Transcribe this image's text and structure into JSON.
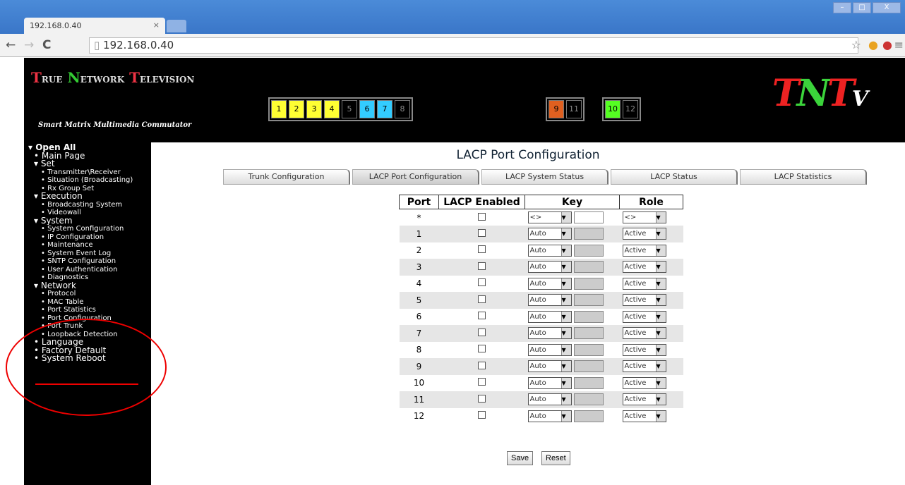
{
  "browser": {
    "tab_title": "192.168.0.40",
    "tab_close": "×",
    "url": "192.168.0.40",
    "back": "←",
    "forward": "→",
    "reload": "C",
    "minimize": "–",
    "maximize": "□",
    "close": "X"
  },
  "header": {
    "logo": {
      "t1": "T",
      "w1": "RUE",
      "n": "N",
      "w2": "ETWORK",
      "t2": "T",
      "w3": "ELEVISION"
    },
    "tagline": "Smart Matrix Multimedia Commutator",
    "ports_a": [
      {
        "label": "1",
        "color": "#ffff33"
      },
      {
        "label": "2",
        "color": "#ffff33"
      },
      {
        "label": "3",
        "color": "#ffff33"
      },
      {
        "label": "4",
        "color": "#ffff33"
      },
      {
        "label": "5",
        "color": "#000000"
      },
      {
        "label": "6",
        "color": "#33ccff"
      },
      {
        "label": "7",
        "color": "#33ccff"
      },
      {
        "label": "8",
        "color": "#000000"
      }
    ],
    "ports_b": [
      {
        "label": "9",
        "color": "#e06020"
      },
      {
        "label": "11",
        "color": "#000000"
      }
    ],
    "ports_c": [
      {
        "label": "10",
        "color": "#55ff22"
      },
      {
        "label": "12",
        "color": "#000000"
      }
    ],
    "brand": {
      "a": "T",
      "b": "N",
      "c": "T",
      "d": "V"
    }
  },
  "sidebar": {
    "items": [
      {
        "label": "▾ Open All",
        "level": 0
      },
      {
        "label": "• Main Page",
        "level": 1
      },
      {
        "label": "▾ Set",
        "level": 1
      },
      {
        "label": "• Transmitter\\Receiver",
        "level": 2
      },
      {
        "label": "• Situation (Broadcasting)",
        "level": 2
      },
      {
        "label": "• Rx Group Set",
        "level": 2
      },
      {
        "label": "▾ Execution",
        "level": 1
      },
      {
        "label": "• Broadcasting System",
        "level": 2
      },
      {
        "label": "• Videowall",
        "level": 2
      },
      {
        "label": "▾ System",
        "level": 1
      },
      {
        "label": "• System Configuration",
        "level": 2
      },
      {
        "label": "• IP Configuration",
        "level": 2
      },
      {
        "label": "• Maintenance",
        "level": 2
      },
      {
        "label": "• System Event Log",
        "level": 2
      },
      {
        "label": "• SNTP Configuration",
        "level": 2
      },
      {
        "label": "• User Authentication",
        "level": 2
      },
      {
        "label": "• Diagnostics",
        "level": 2
      },
      {
        "label": "▾ Network",
        "level": 1
      },
      {
        "label": "• Protocol",
        "level": 2
      },
      {
        "label": "• MAC Table",
        "level": 2
      },
      {
        "label": "• Port Statistics",
        "level": 2
      },
      {
        "label": "• Port Configuration",
        "level": 2
      },
      {
        "label": "• Port Trunk",
        "level": 2
      },
      {
        "label": "• Loopback Detection",
        "level": 2
      },
      {
        "label": "• Language",
        "level": 1
      },
      {
        "label": "• Factory Default",
        "level": 1
      },
      {
        "label": "• System Reboot",
        "level": 1
      }
    ]
  },
  "main": {
    "title": "LACP Port Configuration",
    "tabs": [
      {
        "label": "Trunk Configuration",
        "active": false
      },
      {
        "label": "LACP Port Configuration",
        "active": true
      },
      {
        "label": "LACP System Status",
        "active": false
      },
      {
        "label": "LACP Status",
        "active": false
      },
      {
        "label": "LACP Statistics",
        "active": false
      }
    ],
    "table": {
      "headers": [
        "Port",
        "LACP Enabled",
        "Key",
        "Role"
      ],
      "rows": [
        {
          "port": "*",
          "key": "<>",
          "role": "<>",
          "key_editable": true
        },
        {
          "port": "1",
          "key": "Auto",
          "role": "Active",
          "key_editable": false
        },
        {
          "port": "2",
          "key": "Auto",
          "role": "Active",
          "key_editable": false
        },
        {
          "port": "3",
          "key": "Auto",
          "role": "Active",
          "key_editable": false
        },
        {
          "port": "4",
          "key": "Auto",
          "role": "Active",
          "key_editable": false
        },
        {
          "port": "5",
          "key": "Auto",
          "role": "Active",
          "key_editable": false
        },
        {
          "port": "6",
          "key": "Auto",
          "role": "Active",
          "key_editable": false
        },
        {
          "port": "7",
          "key": "Auto",
          "role": "Active",
          "key_editable": false
        },
        {
          "port": "8",
          "key": "Auto",
          "role": "Active",
          "key_editable": false
        },
        {
          "port": "9",
          "key": "Auto",
          "role": "Active",
          "key_editable": false
        },
        {
          "port": "10",
          "key": "Auto",
          "role": "Active",
          "key_editable": false
        },
        {
          "port": "11",
          "key": "Auto",
          "role": "Active",
          "key_editable": false
        },
        {
          "port": "12",
          "key": "Auto",
          "role": "Active",
          "key_editable": false
        }
      ]
    },
    "save_label": "Save",
    "reset_label": "Reset"
  }
}
